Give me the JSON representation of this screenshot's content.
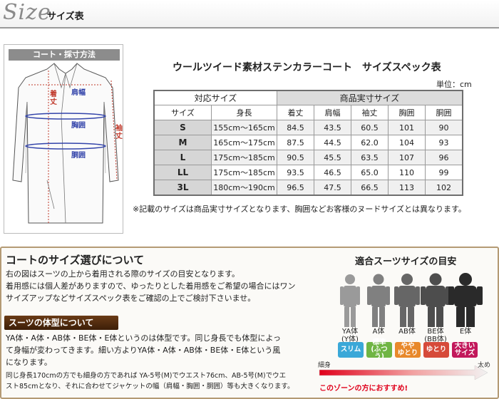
{
  "header": {
    "logo": "Size",
    "subtitle": "サイズ表"
  },
  "diagram": {
    "title": "コート・採寸方法",
    "labels": {
      "length": "着丈",
      "shoulder": "肩幅",
      "chest": "胸囲",
      "waist": "胴囲",
      "sleeve": "袖丈"
    }
  },
  "table": {
    "title": "ウールツイード素材ステンカラーコート　サイズスペック表",
    "unit": "単位：cm",
    "group_left": "対応サイズ",
    "group_right": "商品実寸サイズ",
    "columns": [
      "サイズ",
      "身長",
      "着丈",
      "肩幅",
      "袖丈",
      "胸囲",
      "胴囲"
    ],
    "rows": [
      [
        "S",
        "155cm～165cm",
        "84.5",
        "43.5",
        "60.5",
        "101",
        "90"
      ],
      [
        "M",
        "165cm～175cm",
        "87.5",
        "44.5",
        "62.0",
        "104",
        "93"
      ],
      [
        "L",
        "175cm～185cm",
        "90.5",
        "45.5",
        "63.5",
        "107",
        "96"
      ],
      [
        "LL",
        "175cm～185cm",
        "93.5",
        "46.5",
        "65.0",
        "110",
        "99"
      ],
      [
        "3L",
        "180cm～190cm",
        "96.5",
        "47.5",
        "66.5",
        "113",
        "102"
      ]
    ],
    "note": "※記載のサイズは商品実寸サイズとなります、胸囲などお客様のヌードサイズとは異なります。"
  },
  "about": {
    "title": "コートのサイズ選びについて",
    "text": [
      "右の図はスーツの上から着用される際のサイズの目安となります。",
      "着用感には個人差がありますので、ゆったりとした着用感をご希望の場合にはワン",
      "サイズアップなどサイズスペック表をご確認の上でご検討下さいませ。"
    ],
    "type_badge": "スーツの体型について",
    "type_text": [
      "YA体・A体・AB体・BE体・E体というのは体型です。同じ身長でも体型によっ",
      "て身幅が変わってきます。細い方よりYA体・A体・AB体・BE体・E体という風",
      "になります。"
    ],
    "small_text": [
      "同じ身長170cmの方でも細身の方であれば YA-5号(M)でウエスト76cm、AB-5号(M)でウエ",
      "スト85cmとなり、それに合わせてジャケットの幅（肩幅・胸囲・胴囲）等も大きくなります。"
    ]
  },
  "fit": {
    "title": "適合スーツサイズの目安",
    "figures": [
      {
        "label": "YA体",
        "sub": "(Y体)",
        "color": "#9a9a9a"
      },
      {
        "label": "A体",
        "sub": "",
        "color": "#808080"
      },
      {
        "label": "AB体",
        "sub": "",
        "color": "#666666"
      },
      {
        "label": "BE体",
        "sub": "(BB体)",
        "color": "#4d4d4d"
      },
      {
        "label": "E体",
        "sub": "",
        "color": "#2a2a2a"
      }
    ],
    "tags": [
      {
        "label": "スリム",
        "color": "#3aa8d8"
      },
      {
        "label": "標準\n(ふつう)",
        "color": "#6fb544"
      },
      {
        "label": "やや\nゆとり",
        "color": "#e8892b"
      },
      {
        "label": "ゆとり",
        "color": "#d64a3a"
      },
      {
        "label": "大きい\nサイズ",
        "color": "#c2185b"
      }
    ],
    "slim": "細身",
    "large": "太め",
    "recommend": "このゾーンの方におすすめ!"
  }
}
